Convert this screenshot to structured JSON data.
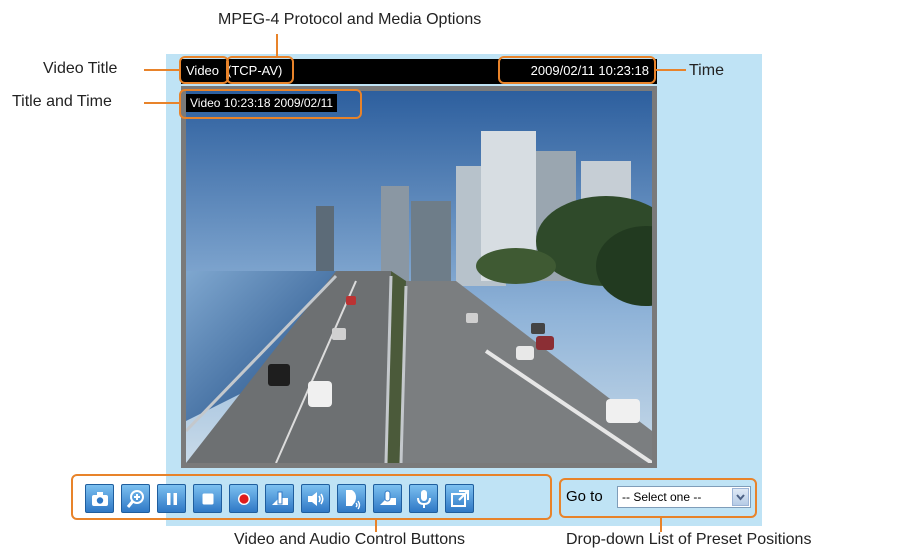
{
  "callouts": {
    "mpeg4": "MPEG-4 Protocol and Media Options",
    "video_title": "Video Title",
    "title_and_time": "Title and Time",
    "time": "Time",
    "controls": "Video and Audio Control Buttons",
    "preset": "Drop-down List of Preset Positions"
  },
  "titlebar": {
    "title": "Video",
    "protocol": "(TCP-AV)",
    "datetime": "2009/02/11 10:23:18"
  },
  "video_overlay": "Video 10:23:18  2009/02/11",
  "controls": [
    {
      "name": "snapshot",
      "icon": "camera-icon"
    },
    {
      "name": "digital-zoom",
      "icon": "zoom-in-icon"
    },
    {
      "name": "pause",
      "icon": "pause-icon"
    },
    {
      "name": "stop",
      "icon": "stop-icon"
    },
    {
      "name": "record",
      "icon": "record-icon"
    },
    {
      "name": "volume",
      "icon": "volume-slider-icon"
    },
    {
      "name": "mute",
      "icon": "speaker-icon"
    },
    {
      "name": "talk",
      "icon": "talk-icon"
    },
    {
      "name": "mic-volume",
      "icon": "mic-slider-icon"
    },
    {
      "name": "microphone",
      "icon": "microphone-icon"
    },
    {
      "name": "fullscreen",
      "icon": "fullscreen-icon"
    }
  ],
  "preset": {
    "goto_label": "Go to",
    "selected": "-- Select one --"
  },
  "colors": {
    "accent": "#e8832a",
    "panel": "#bfe3f5",
    "button": "#2f78c6"
  }
}
